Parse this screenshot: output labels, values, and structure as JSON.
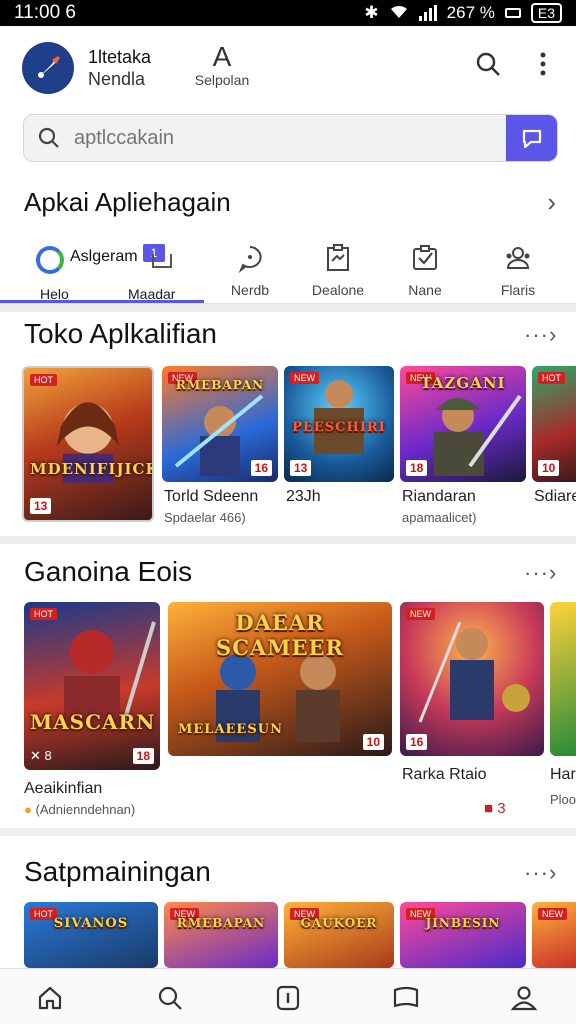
{
  "status_bar": {
    "time": "11:00 6",
    "battery_percent": "267 %",
    "battery_box": "E3"
  },
  "header": {
    "app_name_line1": "1ltetaka",
    "app_name_line2": "Nendla",
    "font_button_glyph": "A",
    "font_button_label": "Selpolan"
  },
  "search": {
    "placeholder": "aptlccakain"
  },
  "title_row": {
    "title": "Apkai Apliehagain"
  },
  "tabs": [
    {
      "label": "Helo",
      "heading": "Aslgeram",
      "badge": "1",
      "icon": "featured-ring-icon"
    },
    {
      "label": "Maadar",
      "icon": "grid-icon"
    },
    {
      "label": "Nerdb",
      "icon": "chat-bubble-icon"
    },
    {
      "label": "Dealone",
      "icon": "clipboard-icon"
    },
    {
      "label": "Nane",
      "icon": "checklist-icon"
    },
    {
      "label": "Flaris",
      "icon": "people-icon"
    }
  ],
  "sections": [
    {
      "title": "Toko Aplkalifian",
      "more": "···›",
      "cards": [
        {
          "cover": "MDENIFIJICK",
          "tag": "HOT",
          "rating": "13",
          "caption": "",
          "subcaption": ""
        },
        {
          "cover": "RMEBAPAN",
          "tag": "NEW",
          "rating": "16",
          "caption": "Torld Sdeenn",
          "subcaption": "Spdaelar 466)"
        },
        {
          "cover": "PEESCHIRI",
          "tag": "NEW",
          "rating": "13",
          "caption": "23Jh",
          "subcaption": ""
        },
        {
          "cover": "TAZGANI",
          "tag": "NEW",
          "rating": "18",
          "caption": "Riandaran",
          "subcaption": "apamaalicet)"
        },
        {
          "cover": "",
          "tag": "HOT",
          "rating": "10",
          "caption": "Sdiare",
          "subcaption": ""
        }
      ]
    },
    {
      "title": "Ganoina Eois",
      "more": "···›",
      "cards": [
        {
          "cover": "MASCARN",
          "tag": "HOT",
          "rating": "18",
          "rating_left": "✕ 8",
          "caption": "Aeaikinfian",
          "subcaption": "(Adnienndehnan)"
        },
        {
          "cover": "DAEAR   SCAMEER",
          "subcover": "MELAEESUN",
          "tag": "",
          "rating": "10",
          "caption": "",
          "subcaption": ""
        },
        {
          "cover": "",
          "tag": "NEW",
          "rating": "16",
          "caption": "Rarka Rtaio",
          "subcaption": "",
          "badge_count": "3"
        },
        {
          "cover": "",
          "tag": "",
          "rating": "",
          "caption": "Har",
          "subcaption": "Ploo"
        }
      ]
    },
    {
      "title": "Satpmainingan",
      "more": "···›",
      "cards": [
        {
          "cover": "SIVANOS"
        },
        {
          "cover": "RMEBAPAN"
        },
        {
          "cover": "GAUKOER"
        },
        {
          "cover": "JINBESIN"
        },
        {
          "cover": ""
        }
      ]
    }
  ],
  "bottom_nav": [
    {
      "label": "home",
      "icon": "home-icon"
    },
    {
      "label": "search",
      "icon": "search-icon"
    },
    {
      "label": "apps",
      "icon": "apps-icon"
    },
    {
      "label": "library",
      "icon": "book-icon"
    },
    {
      "label": "profile",
      "icon": "profile-icon"
    }
  ],
  "colors": {
    "accent": "#5b55e8",
    "tag_red": "#d4201f",
    "logo_blue": "#1f3f8a"
  }
}
